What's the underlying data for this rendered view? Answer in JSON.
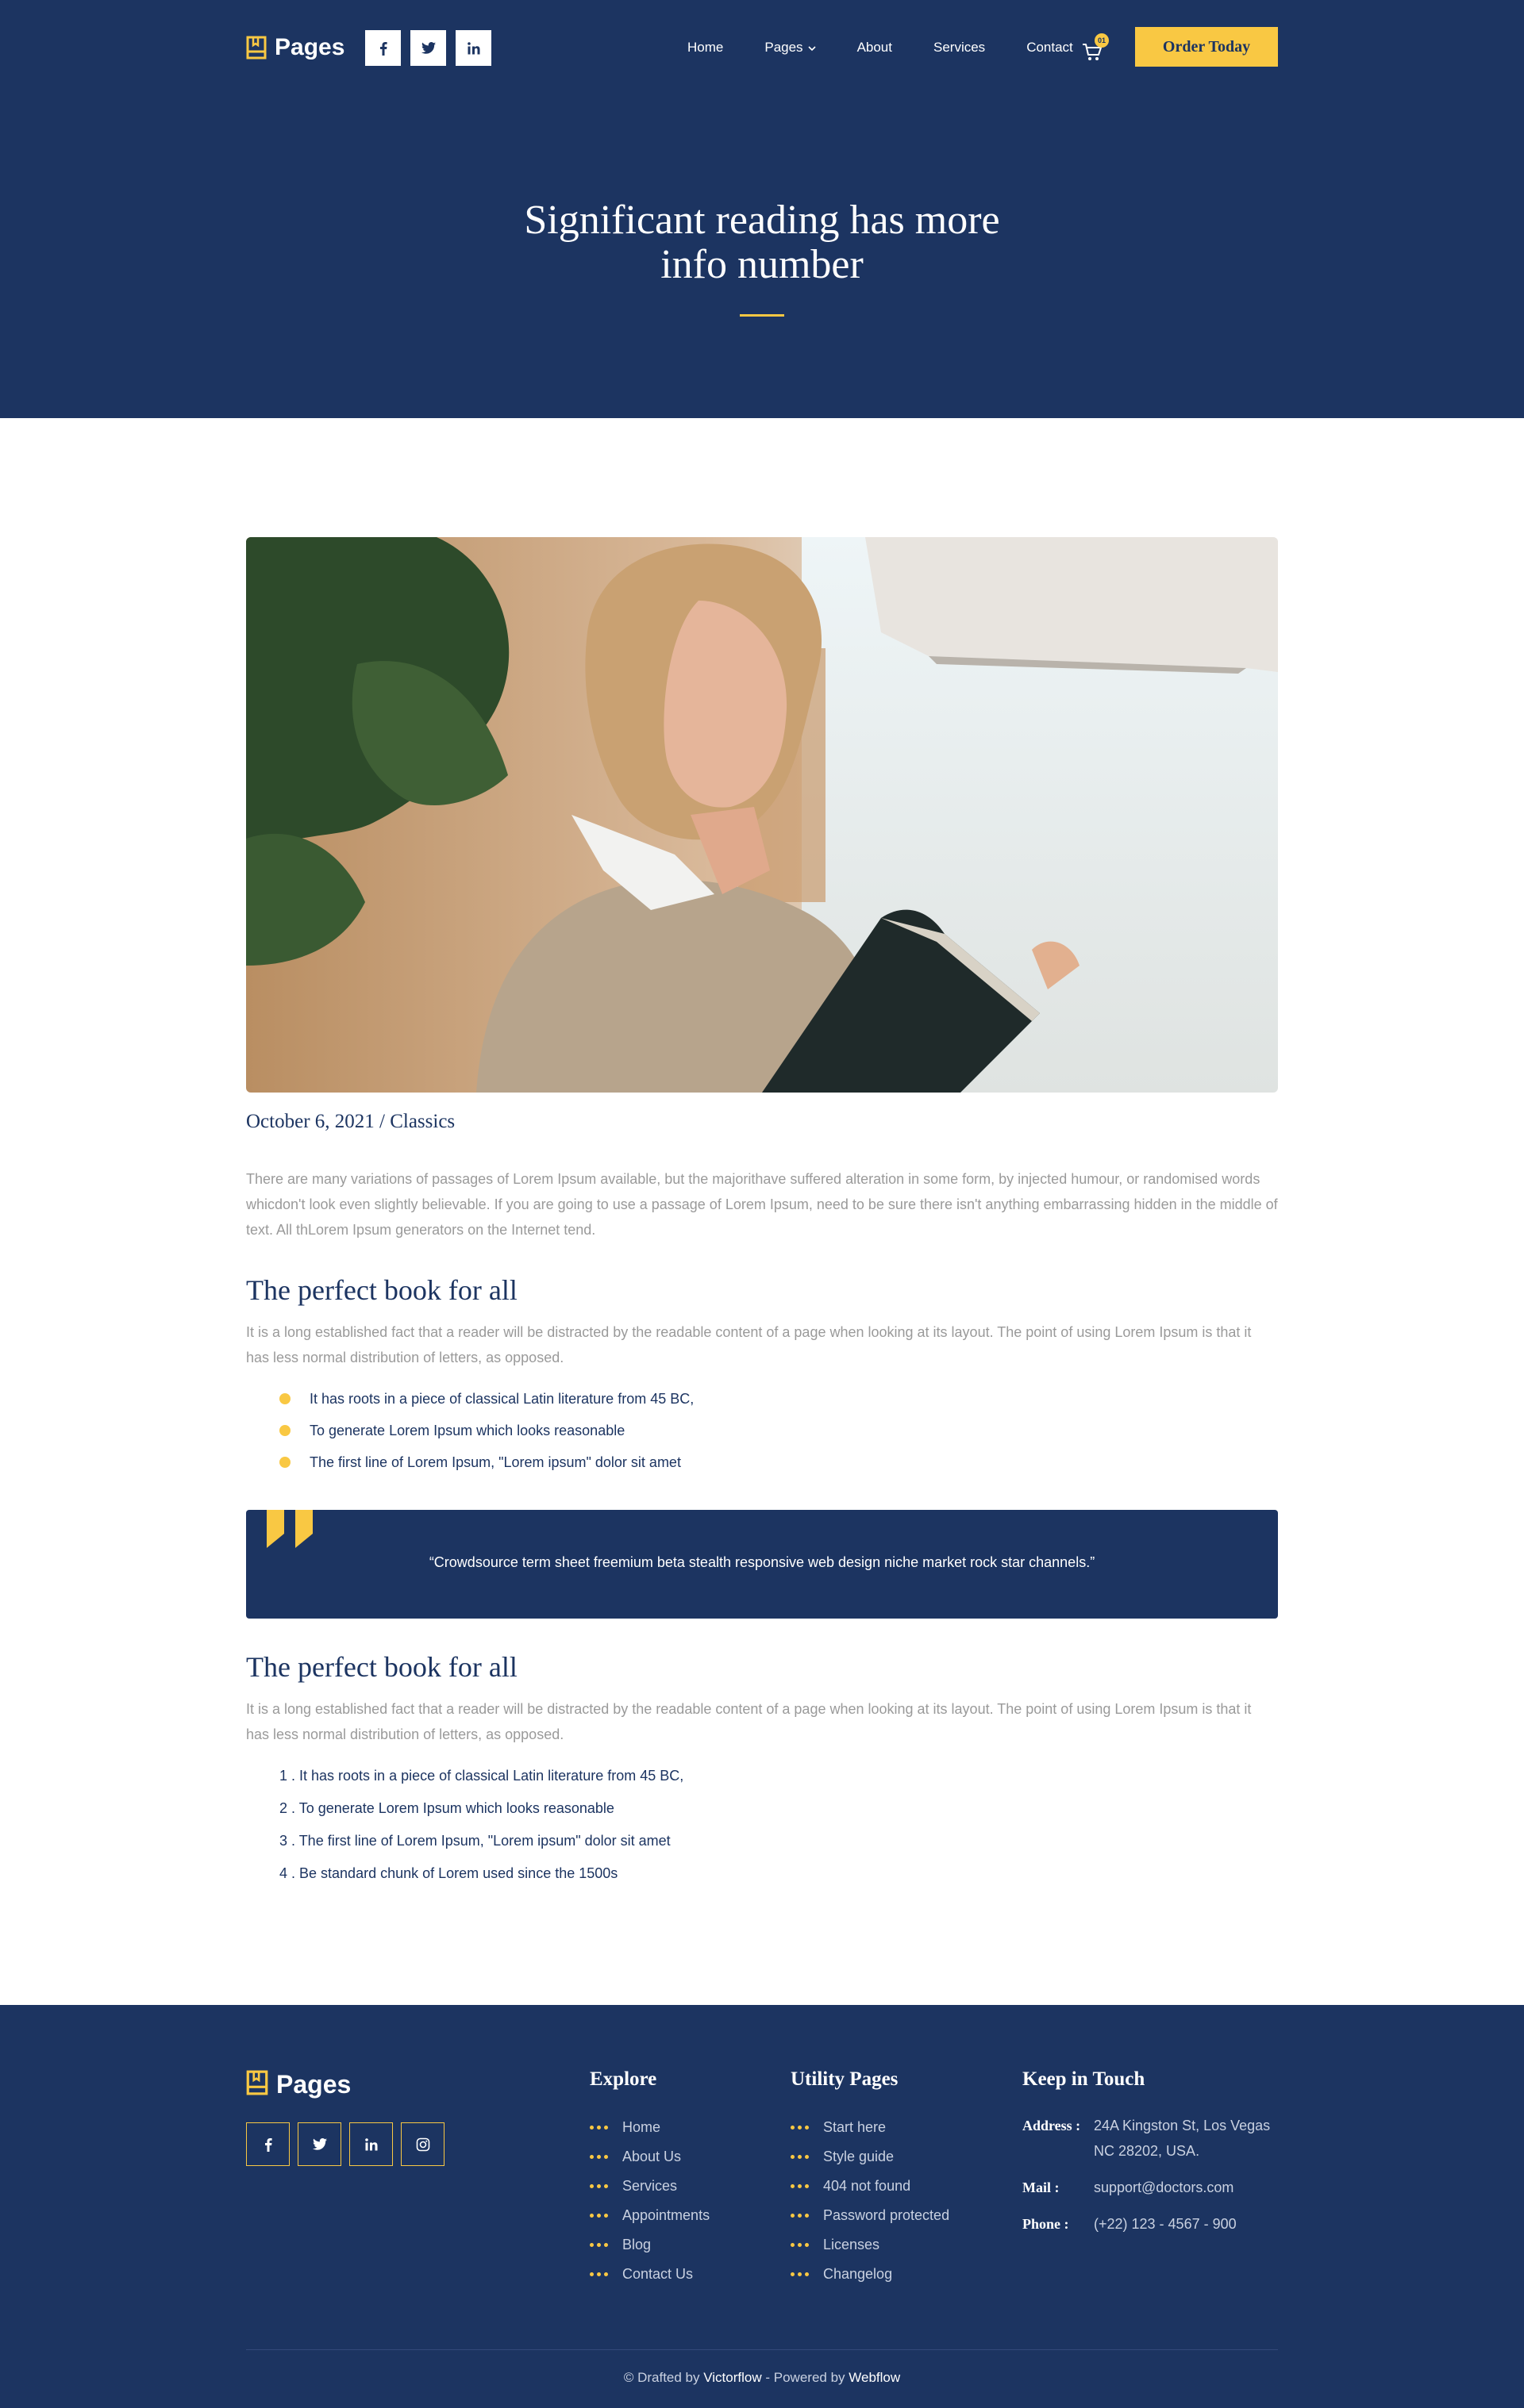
{
  "header": {
    "brand": "Pages",
    "social": [
      "f",
      "t",
      "in"
    ],
    "menu": [
      "Home",
      "Pages",
      "About",
      "Services",
      "Contact"
    ],
    "cart_count": "01",
    "cta": "Order Today"
  },
  "hero": {
    "title_line1": "Significant reading has more",
    "title_line2": "info number"
  },
  "article": {
    "image_icon": "woman-reading-book-photo",
    "meta": "October 6, 2021 / Classics",
    "intro": "There are many variations of passages of Lorem Ipsum available, but the majorithave suffered alteration in some form, by injected humour, or randomised words whicdon't look even slightly believable. If you are going to use a passage of Lorem Ipsum, need to be sure there isn't anything embarrassing hidden in the middle of text. All thLorem Ipsum generators on the Internet tend.",
    "section1": {
      "heading": "The perfect book for all",
      "text": "It is a long established fact that a reader will be distracted by the readable content of a page when looking at its layout. The point of using Lorem Ipsum is that it has less normal distribution of letters, as opposed.",
      "bullets": [
        "It has roots in a piece of classical Latin literature from 45 BC,",
        "To generate Lorem Ipsum which looks reasonable",
        "The first line of Lorem Ipsum, \"Lorem ipsum\" dolor sit amet"
      ]
    },
    "quote": "“Crowdsource term sheet freemium beta stealth responsive web design niche market rock star channels.”",
    "section2": {
      "heading": "The perfect book for all",
      "text": "It is a long established fact that a reader will be distracted by the readable content of a page when looking at its layout. The point of using Lorem Ipsum is that it has less normal distribution of letters, as opposed.",
      "items": [
        "1 . It has roots in a piece of classical Latin literature from 45 BC,",
        "2 . To generate Lorem Ipsum which looks reasonable",
        "3 . The first line of Lorem Ipsum, \"Lorem ipsum\" dolor sit amet",
        "4 . Be standard chunk of Lorem used since the 1500s"
      ]
    }
  },
  "footer": {
    "brand": "Pages",
    "social": [
      "f",
      "t",
      "in",
      "ig"
    ],
    "explore": {
      "title": "Explore",
      "links": [
        "Home",
        "About Us",
        "Services",
        "Appointments",
        "Blog",
        "Contact Us"
      ]
    },
    "utility": {
      "title": "Utility Pages",
      "links": [
        "Start here",
        "Style guide",
        "404 not found",
        "Password protected",
        "Licenses",
        "Changelog"
      ]
    },
    "contact": {
      "title": "Keep in Touch",
      "address_label": "Address :",
      "address": "24A Kingston St, Los Vegas NC 28202, USA.",
      "mail_label": "Mail :",
      "mail": "support@doctors.com",
      "phone_label": "Phone :",
      "phone": "(+22) 123 - 4567 - 900"
    },
    "copyright": {
      "prefix": "© Drafted by",
      "author": "Victorflow",
      "middle": "- Powered by",
      "platform": "Webflow"
    }
  },
  "colors": {
    "navy": "#1c3461",
    "accent": "#f9c843",
    "muted_text": "#9a9a9a"
  }
}
